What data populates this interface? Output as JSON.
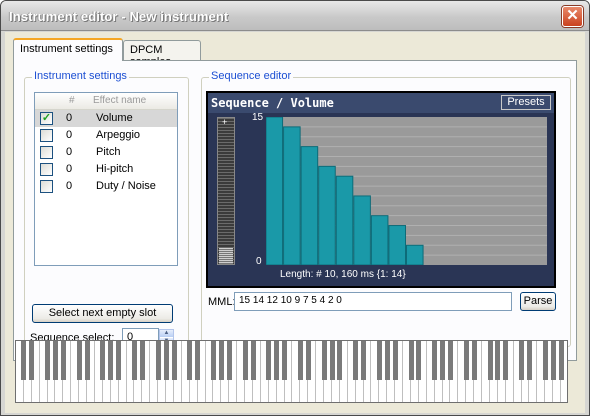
{
  "window": {
    "title": "Instrument editor - New instrument",
    "close_glyph": "✕"
  },
  "tabs": [
    {
      "label": "Instrument settings",
      "active": true
    },
    {
      "label": "DPCM samples",
      "active": false
    }
  ],
  "instrument_settings": {
    "group_label": "Instrument settings",
    "columns": {
      "num": "#",
      "name": "Effect name"
    },
    "rows": [
      {
        "checked": true,
        "value": "0",
        "name": "Volume",
        "selected": true
      },
      {
        "checked": false,
        "value": "0",
        "name": "Arpeggio",
        "selected": false
      },
      {
        "checked": false,
        "value": "0",
        "name": "Pitch",
        "selected": false
      },
      {
        "checked": false,
        "value": "0",
        "name": "Hi-pitch",
        "selected": false
      },
      {
        "checked": false,
        "value": "0",
        "name": "Duty / Noise",
        "selected": false
      }
    ],
    "select_slot_button": "Select next empty slot",
    "sequence_select_label": "Sequence select:",
    "sequence_select_value": "0"
  },
  "sequence_editor": {
    "group_label": "Sequence editor",
    "title": "Sequence / Volume",
    "presets_button": "Presets",
    "ymax_label": "15",
    "ymin_label": "0",
    "scroll_top_glyph": "+",
    "length_text": "Length: # 10, 160 ms {1: 14}",
    "mml_label": "MML:",
    "mml_value": "15 14 12 10 9 7 5 4 2 0",
    "parse_button": "Parse"
  },
  "chart_data": {
    "type": "bar",
    "categories": [
      1,
      2,
      3,
      4,
      5,
      6,
      7,
      8,
      9,
      10
    ],
    "values": [
      15,
      14,
      12,
      10,
      9,
      7,
      5,
      4,
      2,
      0
    ],
    "ylim": [
      0,
      15
    ],
    "slots": 16,
    "bar_color": "#1a99a8",
    "background_color": "#9a9a9a",
    "empty_color": "#8a8a8a"
  },
  "colors": {
    "group_label": "#1c4fd3",
    "active_tab_accent": "#f5a623",
    "seq_header": "#3a4a6e"
  }
}
